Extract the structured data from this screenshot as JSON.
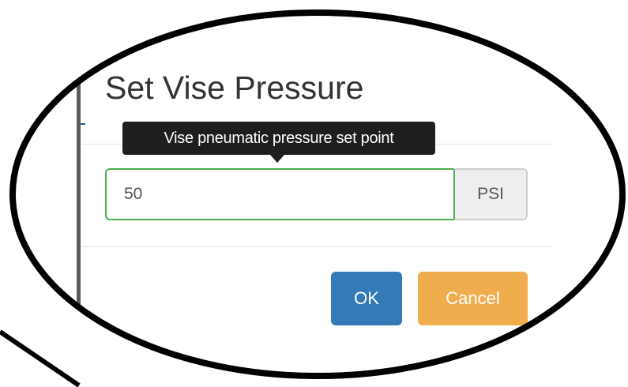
{
  "dialog": {
    "title": "Set Vise Pressure",
    "tooltip": "Vise pneumatic pressure set point",
    "pressure_input": {
      "value": "50",
      "unit": "PSI"
    },
    "ok_label": "OK",
    "cancel_label": "Cancel"
  },
  "colors": {
    "ok_button": "#337ab7",
    "cancel_button": "#f0ad4e",
    "input_valid_border": "#4cae4c",
    "tooltip_background": "#1e1e1e"
  }
}
